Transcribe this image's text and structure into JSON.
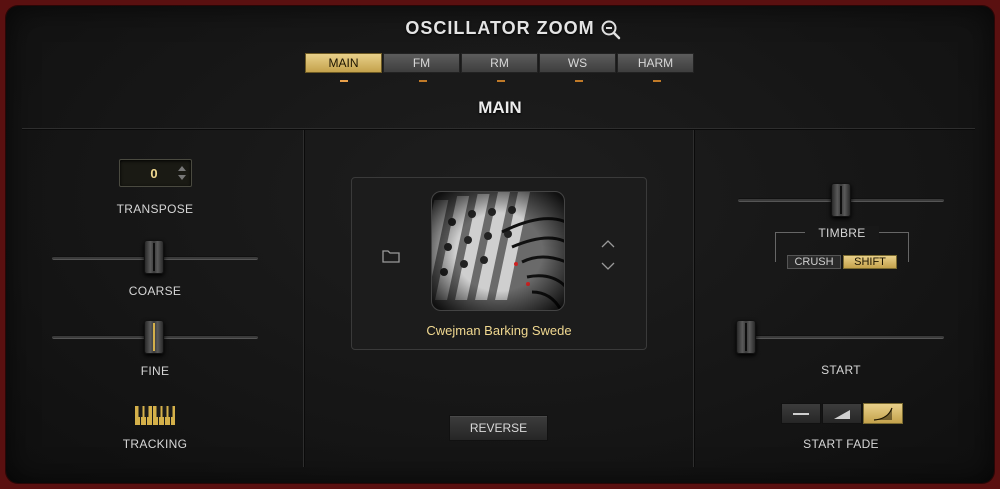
{
  "header": {
    "title": "OSCILLATOR ZOOM"
  },
  "tabs": [
    {
      "label": "MAIN",
      "active": true
    },
    {
      "label": "FM",
      "active": false
    },
    {
      "label": "RM",
      "active": false
    },
    {
      "label": "WS",
      "active": false
    },
    {
      "label": "HARM",
      "active": false
    }
  ],
  "section_title": "MAIN",
  "left": {
    "transpose": {
      "value": "0",
      "label": "TRANSPOSE"
    },
    "coarse": {
      "label": "COARSE",
      "level": 0.5
    },
    "fine": {
      "label": "FINE",
      "level": 0.5
    },
    "tracking": {
      "label": "TRACKING",
      "icon": "piano-keyboard-icon"
    }
  },
  "center": {
    "sample_name": "Cwejman Barking Swede",
    "reverse_label": "REVERSE"
  },
  "right": {
    "timbre": {
      "label": "TIMBRE",
      "level": 0.5,
      "crush_label": "CRUSH",
      "shift_label": "SHIFT",
      "selected": "SHIFT"
    },
    "start": {
      "label": "START",
      "level": 0.0
    },
    "start_fade": {
      "label": "START FADE",
      "options": [
        "flat-line-icon",
        "linear-ramp-icon",
        "curve-ramp-icon"
      ],
      "selected": 2
    }
  },
  "colors": {
    "accent_gold": "#d4b04a",
    "value_text": "#f0d890",
    "frame_red": "#5a1010"
  }
}
